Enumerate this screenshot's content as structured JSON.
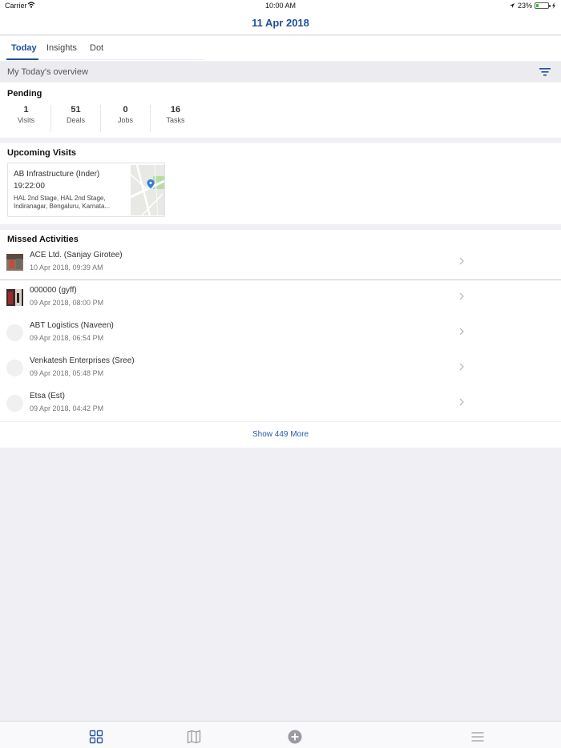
{
  "status_bar": {
    "carrier": "Carrier",
    "time": "10:00 AM",
    "battery": "23%",
    "battery_level": 0.23
  },
  "header": {
    "title": "11 Apr 2018"
  },
  "tabs": [
    {
      "label": "Today",
      "active": true
    },
    {
      "label": "Insights",
      "active": false
    },
    {
      "label": "Dot",
      "active": false
    }
  ],
  "overview": {
    "label": "My Today's overview",
    "filter_icon": "filter-icon"
  },
  "pending": {
    "title": "Pending",
    "stats": [
      {
        "value": "1",
        "label": "Visits"
      },
      {
        "value": "51",
        "label": "Deals"
      },
      {
        "value": "0",
        "label": "Jobs"
      },
      {
        "value": "16",
        "label": "Tasks"
      }
    ]
  },
  "upcoming": {
    "title": "Upcoming Visits",
    "visits": [
      {
        "name": "AB Infrastructure (Inder)",
        "time": "19:22:00",
        "address_line1": "HAL 2nd Stage, HAL 2nd Stage,",
        "address_line2": "Indiranagar, Bengaluru, Karnata..."
      }
    ]
  },
  "missed": {
    "title": "Missed Activities",
    "items": [
      {
        "name": "ACE Ltd. (Sanjay Girotee)",
        "date": "10 Apr 2018, 09:39 AM",
        "avatar": "photo"
      },
      {
        "name": "000000 (gyff)",
        "date": "09 Apr 2018, 08:00 PM",
        "avatar": "photo"
      },
      {
        "name": "ABT Logistics (Naveen)",
        "date": "09 Apr 2018, 06:54 PM",
        "avatar": "placeholder"
      },
      {
        "name": "Venkatesh Enterprises (Sree)",
        "date": "09 Apr 2018, 05:48 PM",
        "avatar": "placeholder"
      },
      {
        "name": "Etsa (Est)",
        "date": "09 Apr 2018, 04:42 PM",
        "avatar": "placeholder"
      }
    ],
    "show_more": "Show 449 More"
  },
  "tabbar": {
    "items": [
      "dashboard-icon",
      "map-icon",
      "add-icon",
      "menu-icon"
    ]
  },
  "colors": {
    "accent": "#1f4f9a",
    "link": "#2a5aa5",
    "background": "#efeff4"
  }
}
